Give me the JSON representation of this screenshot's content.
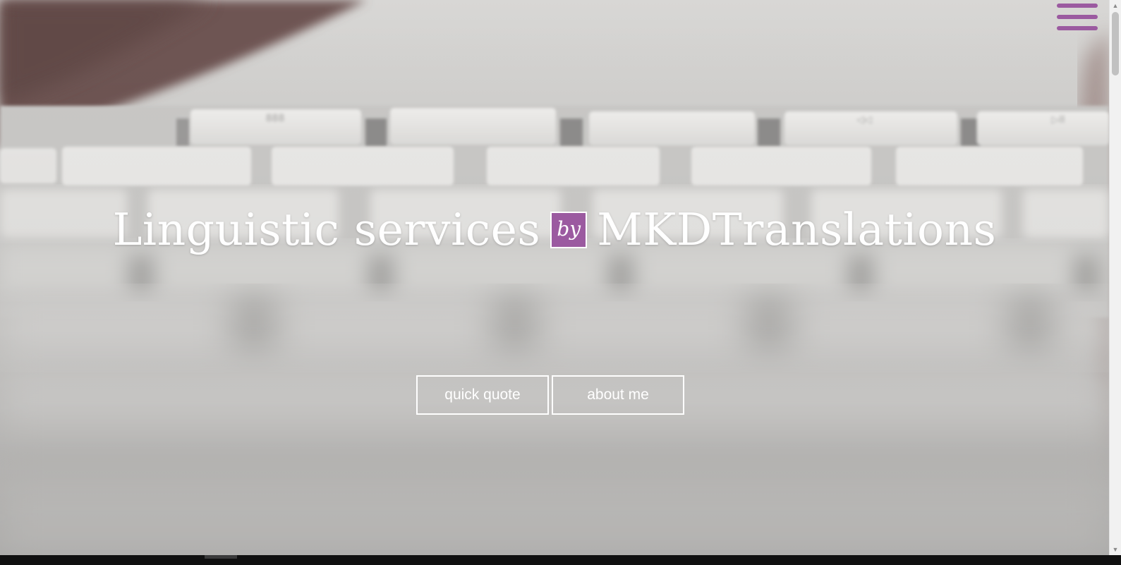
{
  "hero": {
    "headline_before": "Linguistic services",
    "headline_badge": "by",
    "headline_after": "MKDTranslations",
    "background_image": "blurred-white-keyboard-photo"
  },
  "buttons": {
    "quick_quote": "quick quote",
    "about_me": "about me"
  },
  "menu": {
    "icon": "hamburger-menu-icon"
  },
  "colors": {
    "accent": "#9b5aa0",
    "text": "#ffffff"
  }
}
